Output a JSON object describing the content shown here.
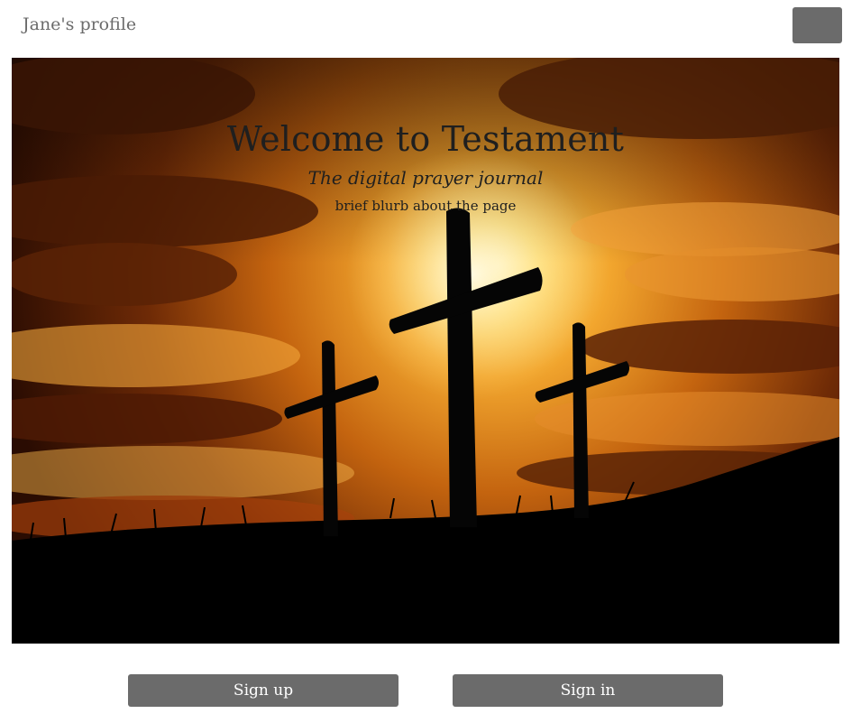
{
  "header": {
    "profile_title": "Jane's profile",
    "menu_button_icon": "menu-button-icon"
  },
  "hero": {
    "title": "Welcome to Testament",
    "subtitle": "The digital prayer journal",
    "blurb": "brief blurb about the page",
    "image_icon": "three-crosses-sunset-image"
  },
  "actions": {
    "signup_label": "Sign up",
    "signin_label": "Sign in"
  },
  "colors": {
    "button_bg": "#6b6b6b",
    "button_text": "#ffffff",
    "title_text": "#6b6b6b"
  }
}
